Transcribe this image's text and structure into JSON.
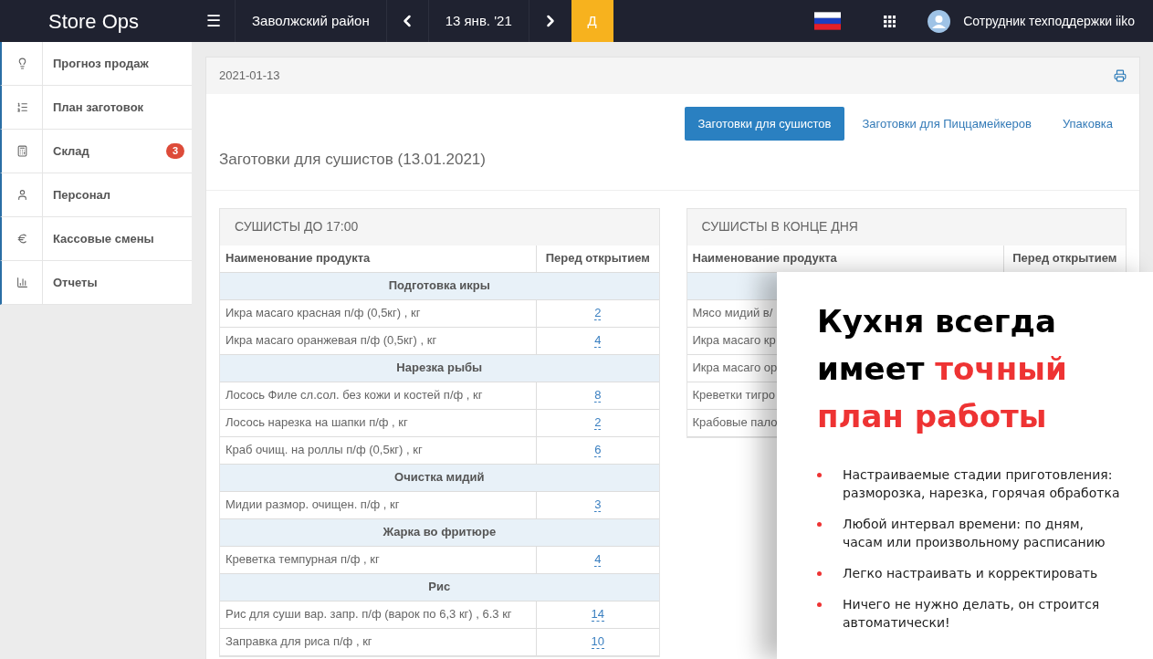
{
  "topbar": {
    "brand": "Store Ops",
    "menu_icon": "☰",
    "location": "Заволжский район",
    "date": "13 янв. '21",
    "period": "Д",
    "user": "Сотрудник техподдержки iiko"
  },
  "sidebar": {
    "items": [
      {
        "label": "Прогноз продаж"
      },
      {
        "label": "План заготовок"
      },
      {
        "label": "Склад",
        "badge": "3"
      },
      {
        "label": "Персонал"
      },
      {
        "label": "Кассовые смены"
      },
      {
        "label": "Отчеты"
      }
    ]
  },
  "card": {
    "date": "2021-01-13",
    "title": "Заготовки для сушистов (13.01.2021)",
    "tabs": [
      {
        "label": "Заготовки для сушистов",
        "selected": true
      },
      {
        "label": "Заготовки для Пиццамейкеров",
        "selected": false
      },
      {
        "label": "Упаковка",
        "selected": false
      }
    ]
  },
  "tables": [
    {
      "title": "СУШИСТЫ ДО 17:00",
      "columns": [
        "Наименование продукта",
        "Перед открытием"
      ],
      "rows": [
        {
          "kind": "group",
          "name": "Подготовка икры"
        },
        {
          "kind": "item",
          "name": "Икра масаго красная п/ф (0,5кг) , кг",
          "value": "2"
        },
        {
          "kind": "item",
          "name": "Икра масаго оранжевая п/ф (0,5кг) , кг",
          "value": "4"
        },
        {
          "kind": "group",
          "name": "Нарезка рыбы"
        },
        {
          "kind": "item",
          "name": "Лосось Филе сл.сол. без кожи и костей п/ф , кг",
          "value": "8"
        },
        {
          "kind": "item",
          "name": "Лосось нарезка на шапки п/ф , кг",
          "value": "2"
        },
        {
          "kind": "item",
          "name": "Краб очищ. на роллы п/ф (0,5кг) , кг",
          "value": "6"
        },
        {
          "kind": "group",
          "name": "Очистка мидий"
        },
        {
          "kind": "item",
          "name": "Мидии размор. очищен. п/ф , кг",
          "value": "3"
        },
        {
          "kind": "group",
          "name": "Жарка во фритюре"
        },
        {
          "kind": "item",
          "name": "Креветка темпурная п/ф , кг",
          "value": "4"
        },
        {
          "kind": "group",
          "name": "Рис"
        },
        {
          "kind": "item",
          "name": "Рис для суши вар. запр. п/ф (варок по 6,3 кг) , 6.3 кг",
          "value": "14"
        },
        {
          "kind": "item",
          "name": "Заправка для риса п/ф , кг",
          "value": "10"
        }
      ]
    },
    {
      "title": "СУШИСТЫ В КОНЦЕ ДНЯ",
      "columns": [
        "Наименование продукта",
        "Перед открытием"
      ],
      "rows": [
        {
          "kind": "group"
        },
        {
          "kind": "item",
          "name": "Мясо мидий в/"
        },
        {
          "kind": "item",
          "name": "Икра масаго кр"
        },
        {
          "kind": "item",
          "name": "Икра масаго ор"
        },
        {
          "kind": "item",
          "name": "Креветки тигро"
        },
        {
          "kind": "item",
          "name": "Крабовые пало"
        }
      ]
    }
  ],
  "promo": {
    "headline_black": "Кухня всегда имеет",
    "headline_red": "точный план работы",
    "bullets": [
      "Настраиваемые стадии приготовления: разморозка, нарезка, горячая обработка",
      "Любой интервал времени: по дням, часам или произвольному расписанию",
      "Легко  настраивать и корректировать",
      "Ничего не нужно делать, он строится автоматически!"
    ]
  }
}
